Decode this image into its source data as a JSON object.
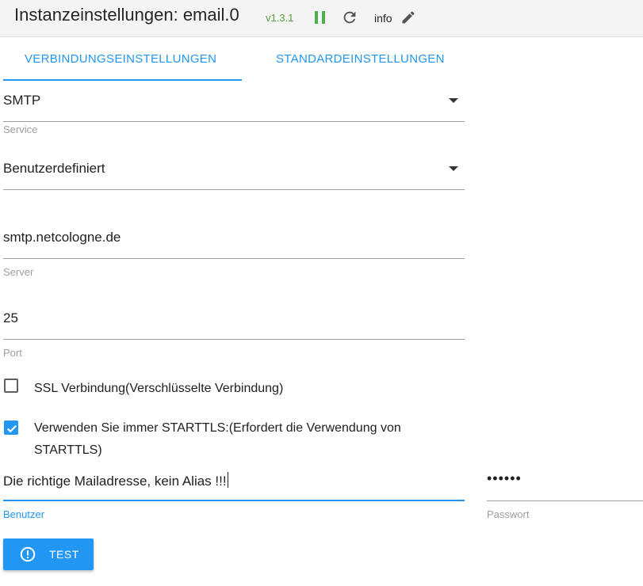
{
  "header": {
    "title": "Instanzeinstellungen: email.0",
    "version": "v1.3.1",
    "info_label": "info",
    "pause_icon": "pause-icon",
    "reload_icon": "reload-icon",
    "edit_icon": "edit-icon"
  },
  "tabs": [
    {
      "label": "VERBINDUNGSEINSTELLUNGEN",
      "active": true
    },
    {
      "label": "STANDARDEINSTELLUNGEN",
      "active": false
    }
  ],
  "form": {
    "transport": {
      "value": "SMTP",
      "label": "Service"
    },
    "service": {
      "value": "Benutzerdefiniert"
    },
    "server": {
      "value": "smtp.netcologne.de",
      "label": "Server"
    },
    "port": {
      "value": "25",
      "label": "Port"
    },
    "ssl": {
      "label": "SSL Verbindung(Verschlüsselte Verbindung)",
      "checked": false
    },
    "starttls": {
      "label_line1": "Verwenden Sie immer STARTTLS:(Erfordert die Verwendung von",
      "label_line2": "STARTTLS)",
      "checked": true
    },
    "user": {
      "value": "Die richtige Mailadresse, kein Alias !!!",
      "label": "Benutzer"
    },
    "password": {
      "value": "••••••",
      "label": "Passwort"
    }
  },
  "test_button": {
    "label": "TEST",
    "icon": "alert-circle-icon"
  },
  "colors": {
    "accent": "#2196f3",
    "version_green": "#5a9e3a",
    "pause_green": "#4caf50"
  }
}
